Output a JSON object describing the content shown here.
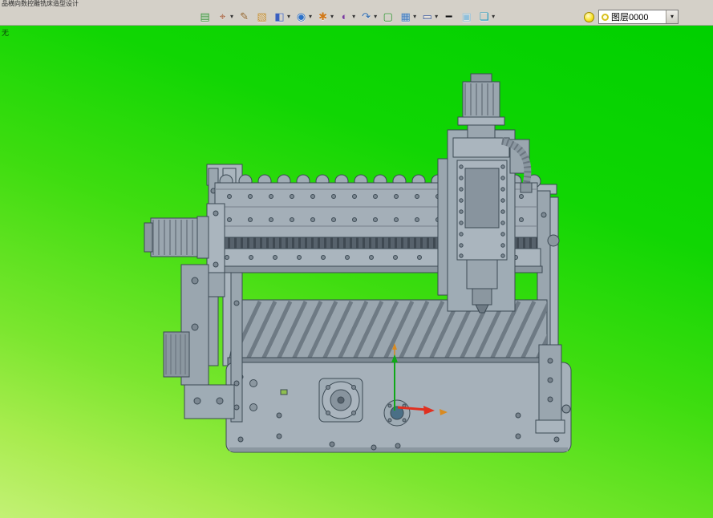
{
  "window": {
    "title": "品横向数控雕铣床造型设计",
    "viewport_label": "无"
  },
  "toolbar": {
    "dropdown_glyph": "▾",
    "buttons": [
      {
        "name": "drawing-sheet-icon",
        "glyph": "▤",
        "color": "#2f8f2f",
        "dropdown": false
      },
      {
        "name": "coordinate-system-icon",
        "glyph": "⌖",
        "color": "#a05028",
        "dropdown": true
      },
      {
        "name": "sketch-pen-icon",
        "glyph": "✎",
        "color": "#8a5a20",
        "dropdown": false
      },
      {
        "name": "solid-block-icon",
        "glyph": "▧",
        "color": "#c08828",
        "dropdown": false
      },
      {
        "name": "extrude-cube-icon",
        "glyph": "◧",
        "color": "#3a5fc0",
        "dropdown": true
      },
      {
        "name": "sphere-surface-icon",
        "glyph": "◉",
        "color": "#2a70c8",
        "dropdown": true
      },
      {
        "name": "gear-wheel-icon",
        "glyph": "✱",
        "color": "#d07818",
        "dropdown": true
      },
      {
        "name": "half-section-icon",
        "glyph": "◐",
        "color": "#7a3aa0",
        "dropdown": true
      },
      {
        "name": "rotate-view-icon",
        "glyph": "↷",
        "color": "#2868b0",
        "dropdown": true
      },
      {
        "name": "select-frame-icon",
        "glyph": "▢",
        "color": "#289028",
        "dropdown": false
      },
      {
        "name": "window-tile-icon",
        "glyph": "▦",
        "color": "#3a78c0",
        "dropdown": true
      },
      {
        "name": "display-mode-icon",
        "glyph": "▭",
        "color": "#3858a0",
        "dropdown": true
      },
      {
        "name": "line-width-icon",
        "glyph": "━",
        "color": "#101010",
        "dropdown": false
      },
      {
        "name": "render-swatch-icon",
        "glyph": "▣",
        "color": "#8fc0dc",
        "dropdown": false
      },
      {
        "name": "layer-stack-icon",
        "glyph": "❏",
        "color": "#1898c0",
        "dropdown": true
      }
    ],
    "layer_selector": {
      "value": "图层0000"
    }
  },
  "colors": {
    "viewport_top": "#00d000",
    "viewport_bottom": "#c3f175",
    "chrome_gray": "#d4d0c8",
    "machine_body": "#a4afb8",
    "machine_dark": "#57626c",
    "machine_outline": "#3c4a54",
    "axis_red": "#e03020",
    "axis_green": "#10a818",
    "axis_orange": "#d98a20"
  }
}
